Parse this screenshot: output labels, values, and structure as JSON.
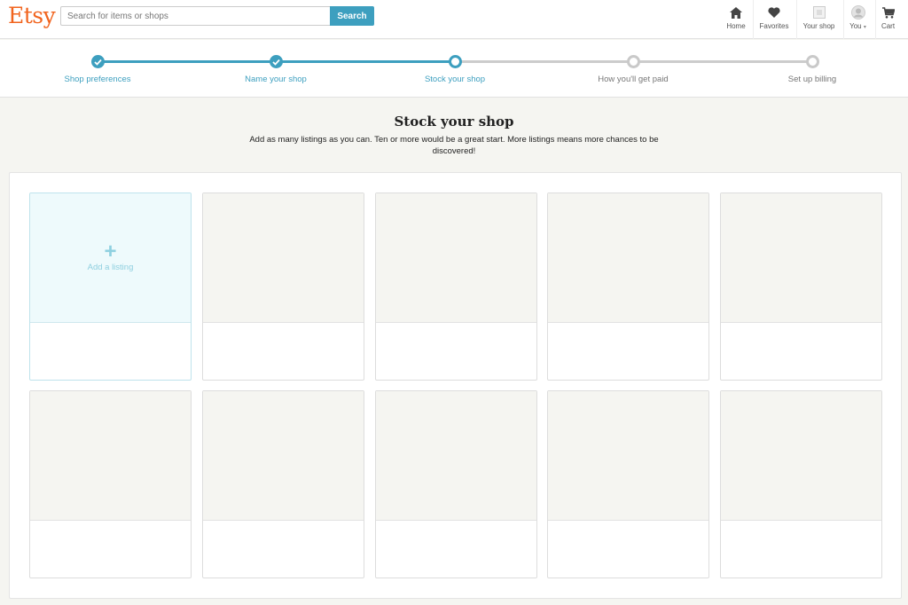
{
  "header": {
    "logo": "Etsy",
    "search": {
      "placeholder": "Search for items or shops",
      "value": "",
      "button_label": "Search"
    },
    "nav": [
      {
        "id": "home",
        "label": "Home",
        "icon": "home-icon"
      },
      {
        "id": "favorites",
        "label": "Favorites",
        "icon": "heart-icon"
      },
      {
        "id": "your-shop",
        "label": "Your shop",
        "icon": "shop-icon"
      },
      {
        "id": "you",
        "label": "You",
        "icon": "avatar-icon",
        "has_dropdown": true
      },
      {
        "id": "cart",
        "label": "Cart",
        "icon": "cart-icon"
      }
    ]
  },
  "steps": [
    {
      "label": "Shop preferences",
      "state": "done"
    },
    {
      "label": "Name your shop",
      "state": "done"
    },
    {
      "label": "Stock your shop",
      "state": "current"
    },
    {
      "label": "How you'll get paid",
      "state": "todo"
    },
    {
      "label": "Set up billing",
      "state": "todo"
    }
  ],
  "main": {
    "title": "Stock your shop",
    "description": "Add as many listings as you can. Ten or more would be a great start. More listings means more chances to be discovered!",
    "add_listing_label": "Add a listing"
  },
  "colors": {
    "accent": "#3d9fbf",
    "brand": "#f1641e",
    "pending": "#c9c9c9"
  }
}
